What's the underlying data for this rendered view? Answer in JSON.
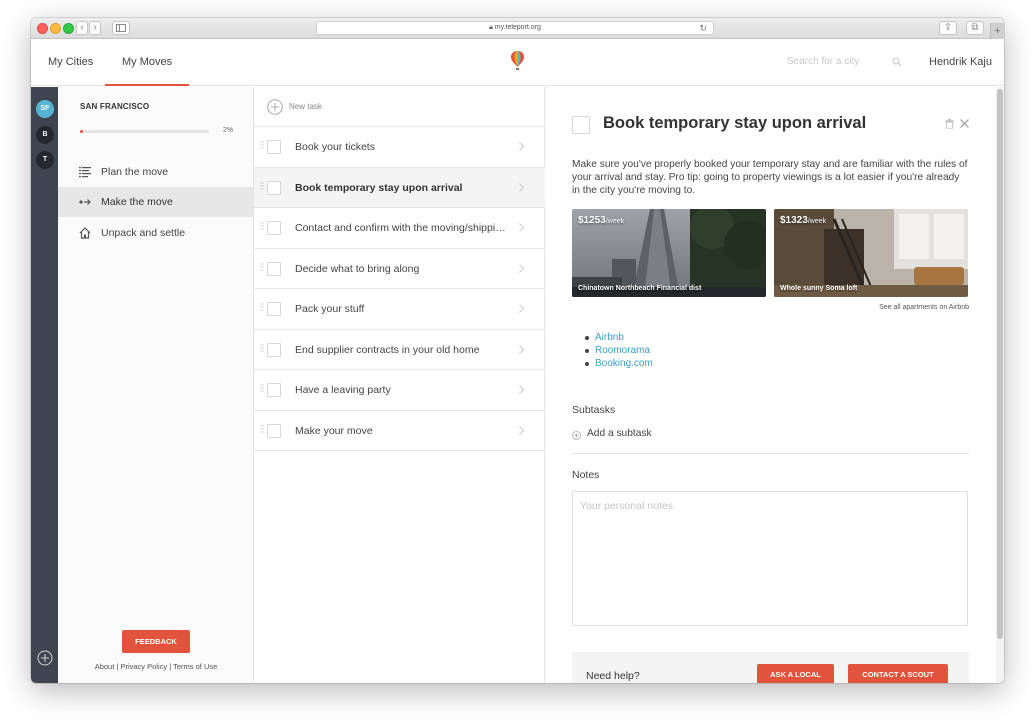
{
  "browser": {
    "url": "my.teleport.org"
  },
  "header": {
    "tabs": [
      {
        "label": "My Cities"
      },
      {
        "label": "My Moves"
      }
    ],
    "search_placeholder": "Search for a city",
    "user_name": "Hendrik Kaju"
  },
  "rail": {
    "cities": [
      {
        "label": "SF",
        "active": true
      },
      {
        "label": "B",
        "active": false
      },
      {
        "label": "T",
        "active": false
      }
    ]
  },
  "sidebar": {
    "city": "SAN FRANCISCO",
    "progress": 2,
    "progress_label": "2%",
    "steps": [
      {
        "label": "Plan the move",
        "icon": "list-icon"
      },
      {
        "label": "Make the move",
        "icon": "arrow-right-icon"
      },
      {
        "label": "Unpack and settle",
        "icon": "home-icon"
      }
    ],
    "feedback_label": "FEEDBACK",
    "footer": {
      "about": "About",
      "sep1": "|",
      "privacy": "Privacy Policy",
      "sep2": "|",
      "terms": "Terms of Use"
    }
  },
  "tasks": {
    "new_task_label": "New task",
    "items": [
      {
        "title": "Book your tickets"
      },
      {
        "title": "Book temporary stay upon arrival"
      },
      {
        "title": "Contact and confirm with the moving/shipping company"
      },
      {
        "title": "Decide what to bring along"
      },
      {
        "title": "Pack your stuff"
      },
      {
        "title": "End supplier contracts in your old home"
      },
      {
        "title": "Have a leaving party"
      },
      {
        "title": "Make your move"
      }
    ]
  },
  "detail": {
    "title": "Book temporary stay upon arrival",
    "description": "Make sure you've properly booked your temporary stay and are familiar with the rules of your arrival and stay. Pro tip: going to property viewings is a lot easier if you're already in the city you're moving to.",
    "apartments": [
      {
        "price": "$1253",
        "unit": "/week",
        "name": "Chinatown Northbeach Financial dist"
      },
      {
        "price": "$1323",
        "unit": "/week",
        "name": "Whole sunny Soma loft"
      }
    ],
    "see_all": "See all apartments on Airbnb",
    "links": [
      "Airbnb",
      "Roomorama",
      "Booking.com"
    ],
    "subtasks_heading": "Subtasks",
    "add_subtask": "Add a subtask",
    "notes_heading": "Notes",
    "notes_placeholder": "Your personal notes",
    "help": {
      "label": "Need help?",
      "ask_local": "ASK A LOCAL",
      "contact_scout": "CONTACT A SCOUT"
    }
  },
  "colors": {
    "accent": "#e2533e",
    "link": "#3aa0c4",
    "rail": "#3f4550",
    "city_active": "#56b4d3"
  }
}
